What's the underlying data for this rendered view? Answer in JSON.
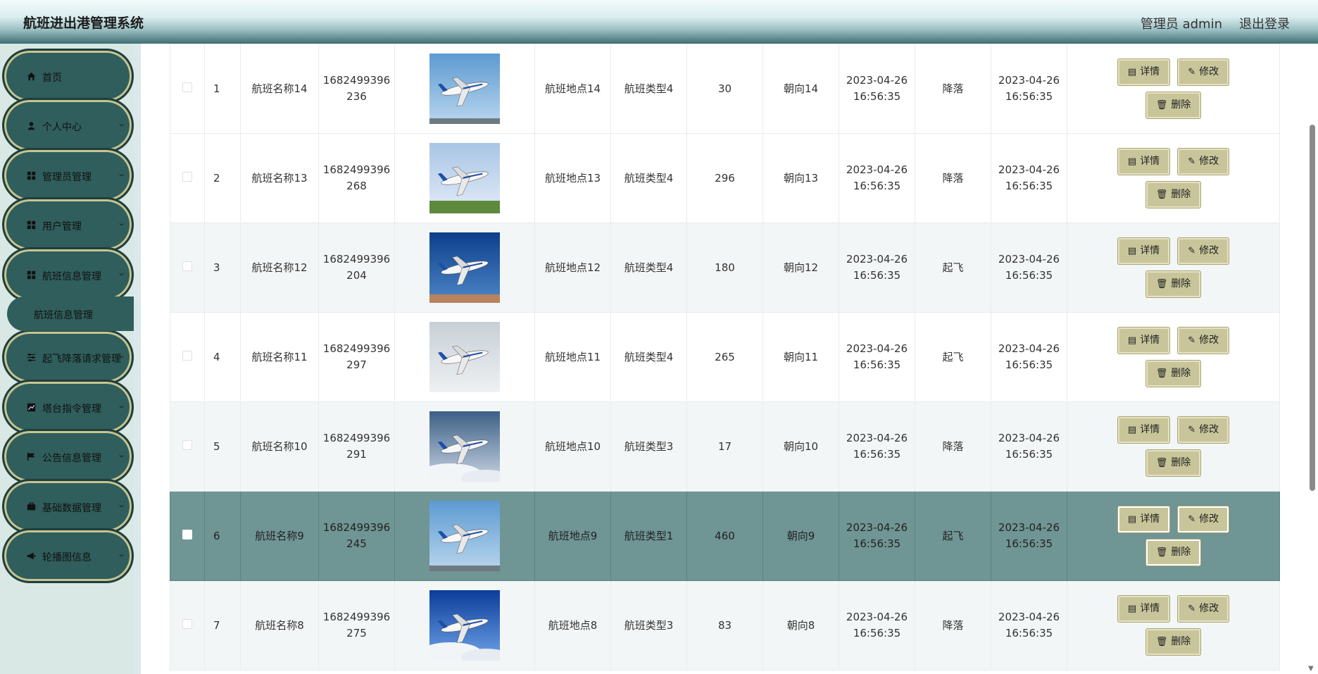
{
  "header": {
    "title": "航班进出港管理系统",
    "user": "管理员 admin",
    "logout": "退出登录"
  },
  "sidebar": {
    "items": [
      {
        "label": "首页",
        "icon": "home-icon",
        "expandable": false
      },
      {
        "label": "个人中心",
        "icon": "user-icon",
        "expandable": true
      },
      {
        "label": "管理员管理",
        "icon": "grid-icon",
        "expandable": true
      },
      {
        "label": "用户管理",
        "icon": "grid-icon",
        "expandable": true
      },
      {
        "label": "航班信息管理",
        "icon": "grid-icon",
        "expandable": true
      },
      {
        "label": "起飞降落请求管理",
        "icon": "sliders-icon",
        "expandable": true
      },
      {
        "label": "塔台指令管理",
        "icon": "chart-icon",
        "expandable": true
      },
      {
        "label": "公告信息管理",
        "icon": "flag-icon",
        "expandable": true
      },
      {
        "label": "基础数据管理",
        "icon": "briefcase-icon",
        "expandable": true
      },
      {
        "label": "轮播图信息",
        "icon": "megaphone-icon",
        "expandable": true
      }
    ],
    "subitem": {
      "label": "航班信息管理"
    }
  },
  "table": {
    "buttons": {
      "detail": "详情",
      "edit": "修改",
      "delete": "删除"
    },
    "rows": [
      {
        "idx": "1",
        "name": "航班名称14",
        "code": "1682499396 236",
        "location": "航班地点14",
        "type": "航班类型4",
        "num": "30",
        "dir": "朝向14",
        "time1": "2023-04-26 16:56:35",
        "status": "降落",
        "time2": "2023-04-26 16:56:35",
        "img": "plane-sky"
      },
      {
        "idx": "2",
        "name": "航班名称13",
        "code": "1682499396 268",
        "location": "航班地点13",
        "type": "航班类型4",
        "num": "296",
        "dir": "朝向13",
        "time1": "2023-04-26 16:56:35",
        "status": "降落",
        "time2": "2023-04-26 16:56:35",
        "img": "plane-landing"
      },
      {
        "idx": "3",
        "name": "航班名称12",
        "code": "1682499396 204",
        "location": "航班地点12",
        "type": "航班类型4",
        "num": "180",
        "dir": "朝向12",
        "time1": "2023-04-26 16:56:35",
        "status": "起飞",
        "time2": "2023-04-26 16:56:35",
        "img": "plane-front"
      },
      {
        "idx": "4",
        "name": "航班名称11",
        "code": "1682499396 297",
        "location": "航班地点11",
        "type": "航班类型4",
        "num": "265",
        "dir": "朝向11",
        "time1": "2023-04-26 16:56:35",
        "status": "起飞",
        "time2": "2023-04-26 16:56:35",
        "img": "plane-climb"
      },
      {
        "idx": "5",
        "name": "航班名称10",
        "code": "1682499396 291",
        "location": "航班地点10",
        "type": "航班类型3",
        "num": "17",
        "dir": "朝向10",
        "time1": "2023-04-26 16:56:35",
        "status": "降落",
        "time2": "2023-04-26 16:56:35",
        "img": "plane-clouds"
      },
      {
        "idx": "6",
        "name": "航班名称9",
        "code": "1682499396 245",
        "location": "航班地点9",
        "type": "航班类型1",
        "num": "460",
        "dir": "朝向9",
        "time1": "2023-04-26 16:56:35",
        "status": "起飞",
        "time2": "2023-04-26 16:56:35",
        "img": "plane-sky"
      },
      {
        "idx": "7",
        "name": "航班名称8",
        "code": "1682499396 275",
        "location": "航班地点8",
        "type": "航班类型3",
        "num": "83",
        "dir": "朝向8",
        "time1": "2023-04-26 16:56:35",
        "status": "降落",
        "time2": "2023-04-26 16:56:35",
        "img": "plane-blue"
      }
    ],
    "selected_row": 6
  }
}
